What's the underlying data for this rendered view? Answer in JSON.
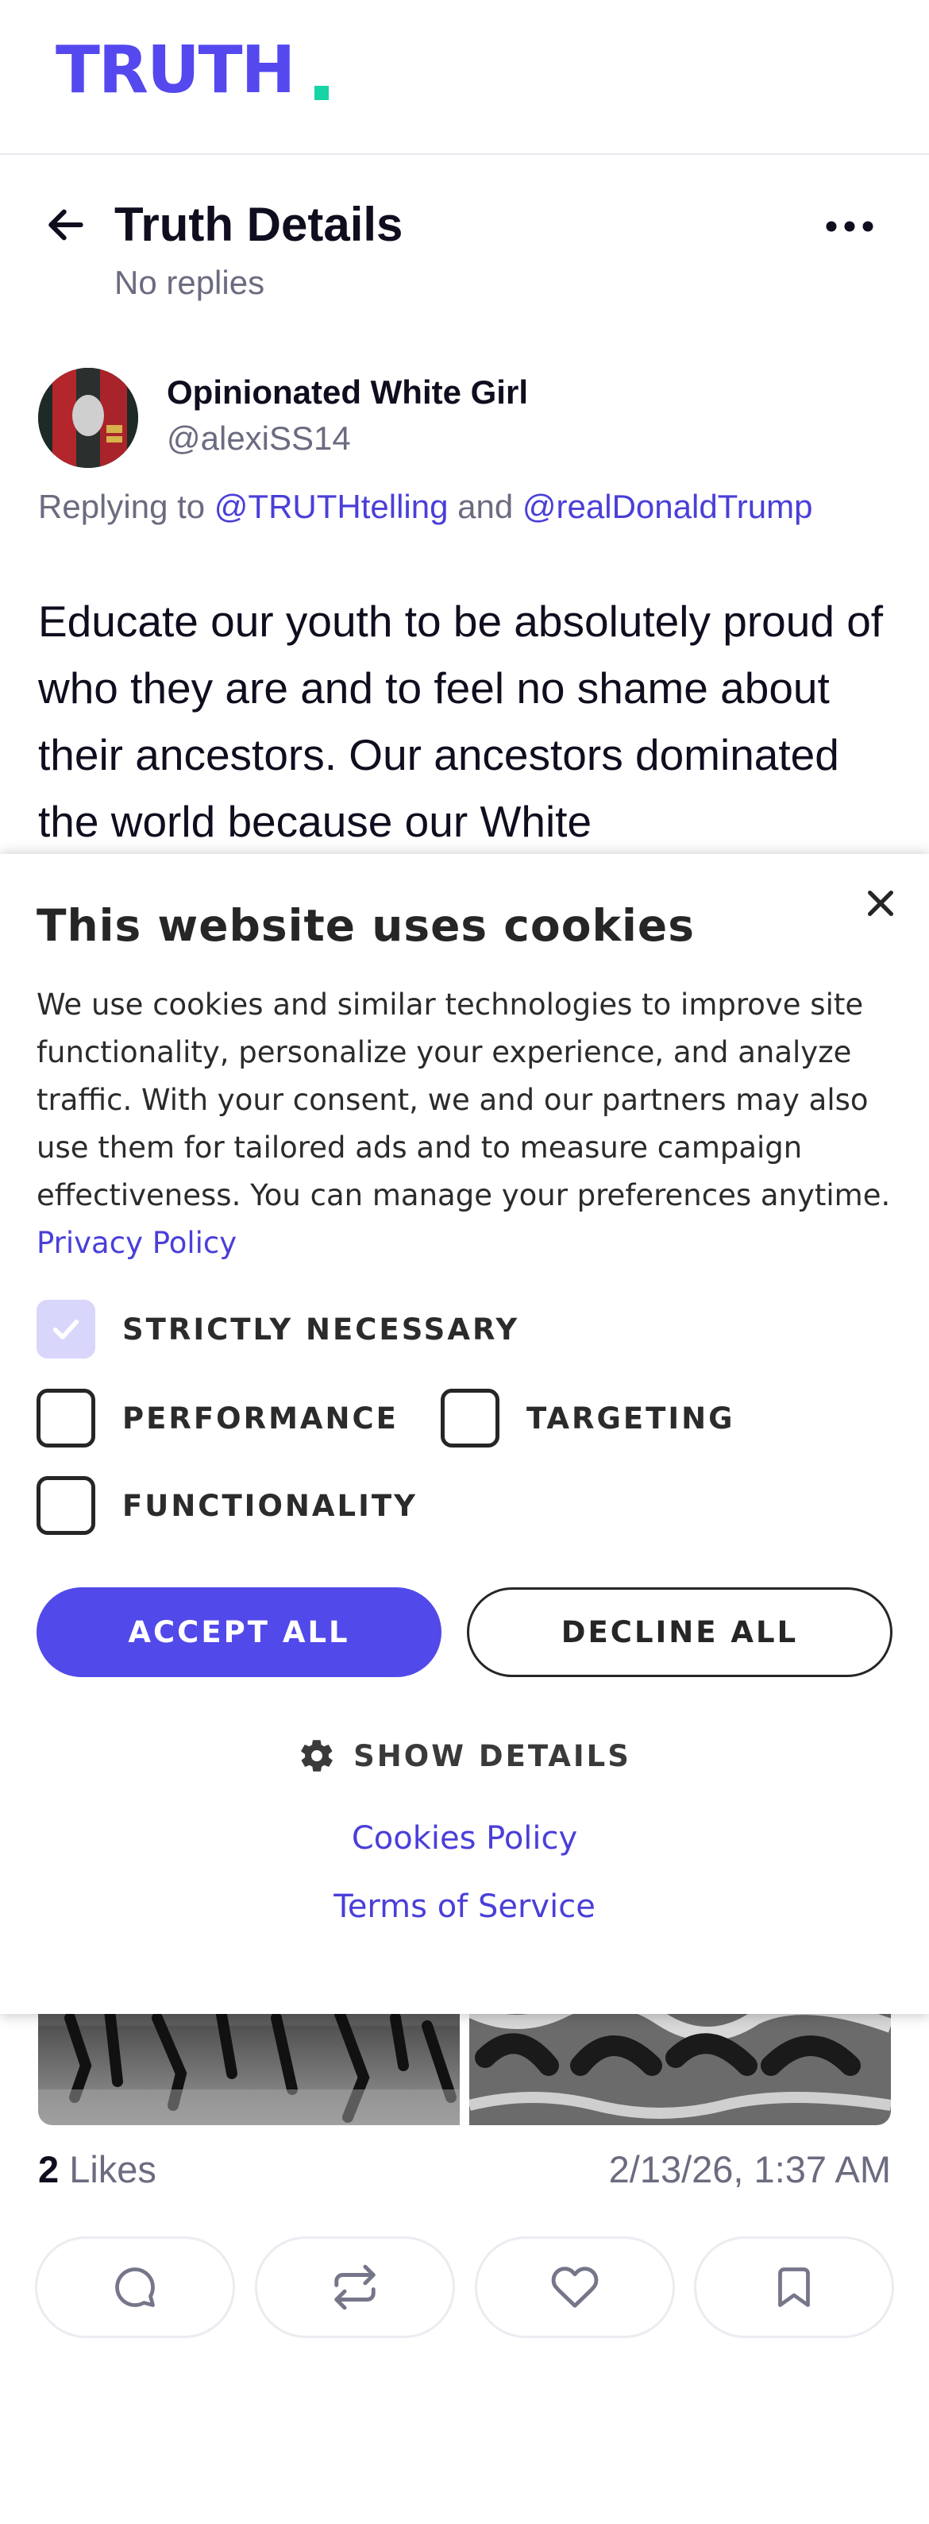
{
  "header": {
    "logo_text": "TRUTH",
    "logo_color": "#5448ee",
    "logo_dot_color": "#17d4a4"
  },
  "title_bar": {
    "title": "Truth Details",
    "subtitle": "No replies",
    "back_icon": "arrow-left-icon",
    "more_icon": "more-horizontal-icon"
  },
  "post": {
    "author_name": "Opinionated White Girl",
    "author_handle": "@alexiSS14",
    "replying_prefix": "Replying to",
    "reply_to_1": "@TRUTHtelling",
    "reply_joiner": "and",
    "reply_to_2": "@realDonaldTrump",
    "text": "Educate our youth to be absolutely proud of who they are and to feel no shame about their ancestors. Our ancestors dominated the world because our White",
    "likes_count": "2",
    "likes_label": "Likes",
    "timestamp": "2/13/26, 1:37 AM"
  },
  "actions": [
    {
      "icon": "reply-bubble-icon"
    },
    {
      "icon": "repost-icon"
    },
    {
      "icon": "heart-icon"
    },
    {
      "icon": "bookmark-icon"
    }
  ],
  "cookie_banner": {
    "title": "This website uses cookies",
    "body": "We use cookies and similar technologies to improve site functionality, personalize your experience, and analyze traffic. With your consent, we and our partners may also use them for tailored ads and to measure campaign effectiveness. You can manage your preferences anytime.",
    "privacy_link": "Privacy Policy",
    "options": {
      "strictly_necessary": "STRICTLY NECESSARY",
      "performance": "PERFORMANCE",
      "targeting": "TARGETING",
      "functionality": "FUNCTIONALITY"
    },
    "accept_label": "ACCEPT ALL",
    "decline_label": "DECLINE ALL",
    "show_details_label": "SHOW DETAILS",
    "cookies_policy_link": "Cookies Policy",
    "terms_link": "Terms of Service",
    "accent_color": "#5249ea"
  }
}
